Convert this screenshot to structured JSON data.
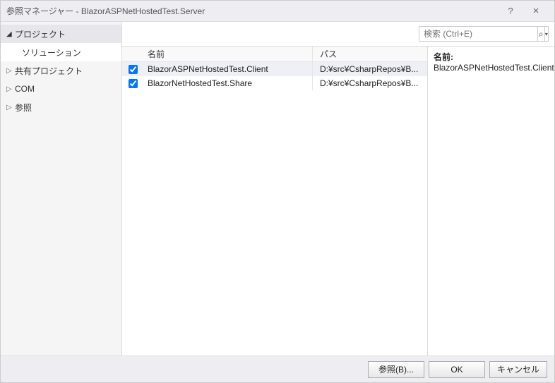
{
  "window": {
    "title": "参照マネージャー - BlazorASPNetHostedTest.Server"
  },
  "sidebar": {
    "items": [
      {
        "label": "プロジェクト",
        "expanded": true,
        "sub": [
          {
            "label": "ソリューション"
          }
        ]
      },
      {
        "label": "共有プロジェクト",
        "expanded": false
      },
      {
        "label": "COM",
        "expanded": false
      },
      {
        "label": "参照",
        "expanded": false
      }
    ]
  },
  "search": {
    "placeholder": "検索 (Ctrl+E)"
  },
  "columns": {
    "name": "名前",
    "path": "パス"
  },
  "rows": [
    {
      "checked": true,
      "name": "BlazorASPNetHostedTest.Client",
      "path": "D:¥src¥CsharpRepos¥B..."
    },
    {
      "checked": true,
      "name": "BlazorNetHostedTest.Share",
      "path": "D:¥src¥CsharpRepos¥B..."
    }
  ],
  "details": {
    "name_label": "名前:",
    "name_value": "BlazorASPNetHostedTest.Client"
  },
  "footer": {
    "browse": "参照(B)...",
    "ok": "OK",
    "cancel": "キャンセル"
  }
}
